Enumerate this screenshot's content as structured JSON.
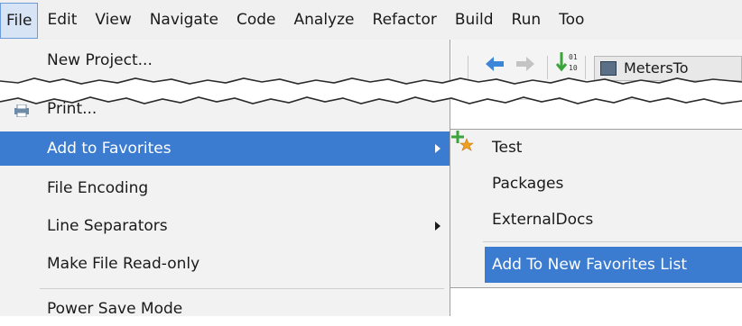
{
  "menubar": {
    "items": [
      "File",
      "Edit",
      "View",
      "Navigate",
      "Code",
      "Analyze",
      "Refactor",
      "Build",
      "Run",
      "Too"
    ]
  },
  "toolbar": {
    "back_icon": "back-arrow-icon",
    "forward_icon": "forward-arrow-icon",
    "sort_icon": "sort-numeric-icon",
    "run_config_label": "MetersTo"
  },
  "file_menu": {
    "new_project": "New Project...",
    "print": "Print...",
    "add_to_favorites": "Add to Favorites",
    "file_encoding": "File Encoding",
    "line_separators": "Line Separators",
    "make_read_only": "Make File Read-only",
    "power_save": "Power Save Mode"
  },
  "favorites_submenu": {
    "items": [
      "Test",
      "Packages",
      "ExternalDocs"
    ],
    "add_new": "Add To New Favorites List"
  },
  "colors": {
    "selection": "#3b7bd0",
    "menu_bg": "#f2f2f2"
  }
}
